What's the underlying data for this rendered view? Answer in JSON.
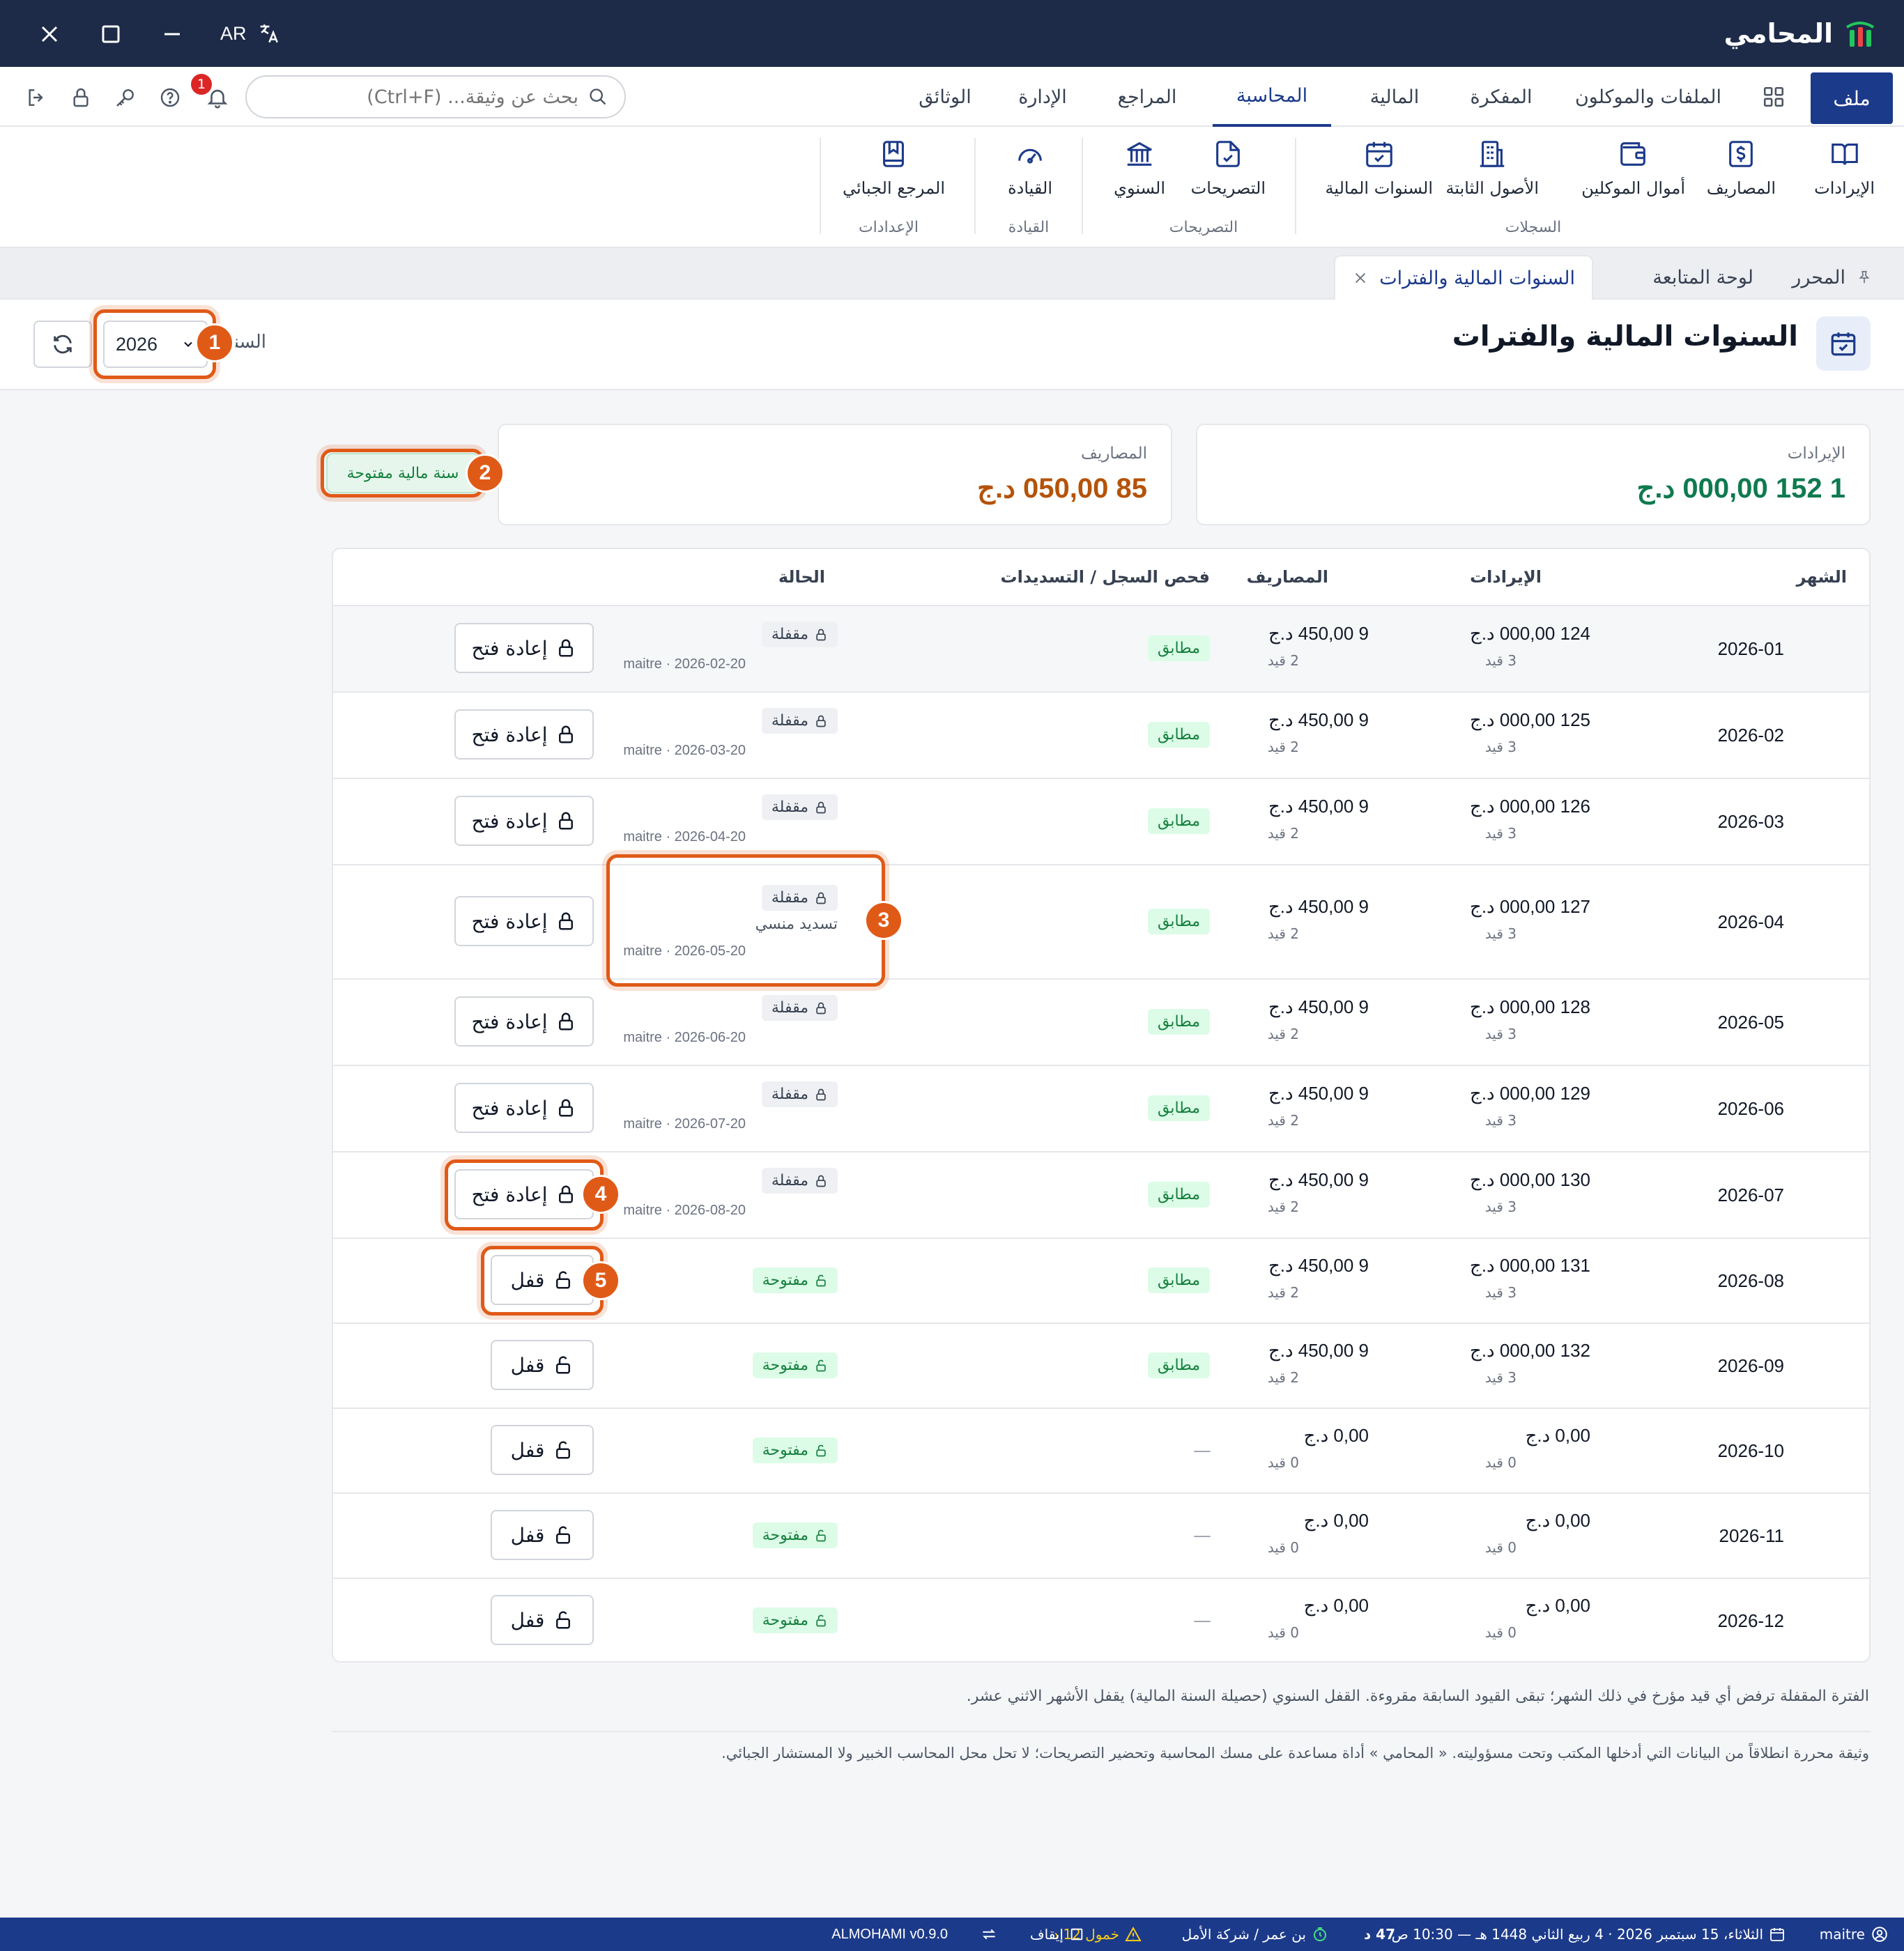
{
  "app": {
    "title": "المحامي",
    "lang": "AR"
  },
  "nav": {
    "file": "ملف",
    "tabs": [
      "الملفات والموكلون",
      "المفكرة",
      "المالية",
      "المحاسبة",
      "المراجع",
      "الإدارة",
      "الوثائق"
    ],
    "active_tab": "المحاسبة",
    "search_placeholder": "بحث عن وثيقة... (Ctrl+F)",
    "notification_count": "1"
  },
  "ribbon": {
    "items": [
      "الإيرادات",
      "المصاريف",
      "أموال الموكلين",
      "الأصول الثابتة",
      "السنوات المالية",
      "التصريحات",
      "السنوي",
      "القيادة",
      "المرجع الجبائي"
    ],
    "groups": [
      "السجلات",
      "التصريحات",
      "القيادة",
      "الإعدادات"
    ]
  },
  "doc_tabs": {
    "editor": "المحرر",
    "dashboard": "لوحة المتابعة",
    "active": "السنوات المالية والفترات"
  },
  "page": {
    "title": "السنوات المالية والفترات",
    "year_label": "السنة",
    "year_value": "2026"
  },
  "summary": {
    "revenue_label": "الإيرادات",
    "revenue_value": "1 152 000,00 د.ج",
    "expenses_label": "المصاريف",
    "expenses_value": "85 050,00 د.ج",
    "year_status": "سنة مالية مفتوحة"
  },
  "table": {
    "headers": {
      "month": "الشهر",
      "revenue": "الإيرادات",
      "expenses": "المصاريف",
      "check": "فحص السجل / التسديدات",
      "status": "الحالة"
    },
    "rows": [
      {
        "month": "2026-01",
        "revenue": "124 000,00 د.ج",
        "revenue_entries": "3 قيد",
        "expenses": "9 450,00 د.ج",
        "expenses_entries": "2 قيد",
        "check": "مطابق",
        "status": "مقفلة",
        "note": "",
        "meta": "maitre · 2026-02-20",
        "action": "إعادة فتح"
      },
      {
        "month": "2026-02",
        "revenue": "125 000,00 د.ج",
        "revenue_entries": "3 قيد",
        "expenses": "9 450,00 د.ج",
        "expenses_entries": "2 قيد",
        "check": "مطابق",
        "status": "مقفلة",
        "note": "",
        "meta": "maitre · 2026-03-20",
        "action": "إعادة فتح"
      },
      {
        "month": "2026-03",
        "revenue": "126 000,00 د.ج",
        "revenue_entries": "3 قيد",
        "expenses": "9 450,00 د.ج",
        "expenses_entries": "2 قيد",
        "check": "مطابق",
        "status": "مقفلة",
        "note": "",
        "meta": "maitre · 2026-04-20",
        "action": "إعادة فتح"
      },
      {
        "month": "2026-04",
        "revenue": "127 000,00 د.ج",
        "revenue_entries": "3 قيد",
        "expenses": "9 450,00 د.ج",
        "expenses_entries": "2 قيد",
        "check": "مطابق",
        "status": "مقفلة",
        "note": "تسديد منسي",
        "meta": "maitre · 2026-05-20",
        "action": "إعادة فتح"
      },
      {
        "month": "2026-05",
        "revenue": "128 000,00 د.ج",
        "revenue_entries": "3 قيد",
        "expenses": "9 450,00 د.ج",
        "expenses_entries": "2 قيد",
        "check": "مطابق",
        "status": "مقفلة",
        "note": "",
        "meta": "maitre · 2026-06-20",
        "action": "إعادة فتح"
      },
      {
        "month": "2026-06",
        "revenue": "129 000,00 د.ج",
        "revenue_entries": "3 قيد",
        "expenses": "9 450,00 د.ج",
        "expenses_entries": "2 قيد",
        "check": "مطابق",
        "status": "مقفلة",
        "note": "",
        "meta": "maitre · 2026-07-20",
        "action": "إعادة فتح"
      },
      {
        "month": "2026-07",
        "revenue": "130 000,00 د.ج",
        "revenue_entries": "3 قيد",
        "expenses": "9 450,00 د.ج",
        "expenses_entries": "2 قيد",
        "check": "مطابق",
        "status": "مقفلة",
        "note": "",
        "meta": "maitre · 2026-08-20",
        "action": "إعادة فتح"
      },
      {
        "month": "2026-08",
        "revenue": "131 000,00 د.ج",
        "revenue_entries": "3 قيد",
        "expenses": "9 450,00 د.ج",
        "expenses_entries": "2 قيد",
        "check": "مطابق",
        "status": "مفتوحة",
        "note": "",
        "meta": "",
        "action": "قفل"
      },
      {
        "month": "2026-09",
        "revenue": "132 000,00 د.ج",
        "revenue_entries": "3 قيد",
        "expenses": "9 450,00 د.ج",
        "expenses_entries": "2 قيد",
        "check": "مطابق",
        "status": "مفتوحة",
        "note": "",
        "meta": "",
        "action": "قفل"
      },
      {
        "month": "2026-10",
        "revenue": "0,00 د.ج",
        "revenue_entries": "0 قيد",
        "expenses": "0,00 د.ج",
        "expenses_entries": "0 قيد",
        "check": "—",
        "status": "مفتوحة",
        "note": "",
        "meta": "",
        "action": "قفل"
      },
      {
        "month": "2026-11",
        "revenue": "0,00 د.ج",
        "revenue_entries": "0 قيد",
        "expenses": "0,00 د.ج",
        "expenses_entries": "0 قيد",
        "check": "—",
        "status": "مفتوحة",
        "note": "",
        "meta": "",
        "action": "قفل"
      },
      {
        "month": "2026-12",
        "revenue": "0,00 د.ج",
        "revenue_entries": "0 قيد",
        "expenses": "0,00 د.ج",
        "expenses_entries": "0 قيد",
        "check": "—",
        "status": "مفتوحة",
        "note": "",
        "meta": "",
        "action": "قفل"
      }
    ]
  },
  "footnotes": {
    "period_note": "الفترة المقفلة ترفض أي قيد مؤرخ في ذلك الشهر؛ تبقى القيود السابقة مقروءة. القفل السنوي (حصيلة السنة المالية) يقفل الأشهر الاثني عشر.",
    "disclaimer": "وثيقة محررة انطلاقاً من البيانات التي أدخلها المكتب وتحت مسؤوليته. « المحامي » أداة مساعدة على مسك المحاسبة وتحضير التصريحات؛ لا تحل محل المحاسب الخبير ولا المستشار الجبائي."
  },
  "annotations": [
    "1",
    "2",
    "3",
    "4",
    "5"
  ],
  "statusbar": {
    "user": "maitre",
    "date": "الثلاثاء، 15 سبتمبر 2026 · 4 ربيع الثاني 1448 هـ — 10:30 ص",
    "amount": "47 د",
    "client": "بن عمر / شركة الأمل",
    "warning": "خمول 12 د",
    "pause": "إيقاف",
    "version": "ALMOHAMI v0.9.0"
  },
  "colors": {
    "brand": "#1c3a8a",
    "titlebar": "#1d2b48",
    "annotation": "#e05a17",
    "revenue_value": "#0f7a4f",
    "expenses_value": "#b45309",
    "open_green": "#15803d"
  }
}
